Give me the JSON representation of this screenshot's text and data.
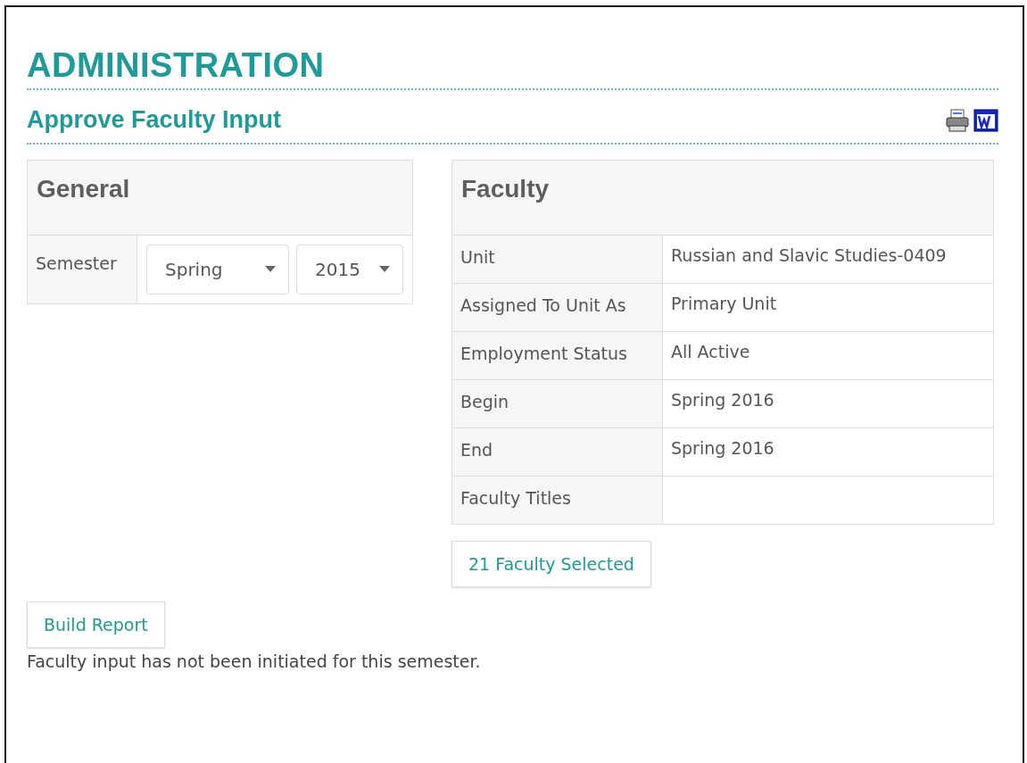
{
  "page_title": "ADMINISTRATION",
  "section_title": "Approve Faculty Input",
  "general": {
    "title": "General",
    "field_label": "Semester",
    "selects": [
      {
        "value": "Spring"
      },
      {
        "value": "2015"
      }
    ]
  },
  "faculty": {
    "title": "Faculty",
    "rows": [
      {
        "label": "Unit",
        "value": "Russian and Slavic Studies-0409"
      },
      {
        "label": "Assigned To Unit As",
        "value": "Primary Unit"
      },
      {
        "label": "Employment Status",
        "value": "All Active"
      },
      {
        "label": "Begin",
        "value": "Spring 2016"
      },
      {
        "label": "End",
        "value": "Spring 2016"
      },
      {
        "label": "Faculty Titles"
      }
    ],
    "selected_button": "21 Faculty Selected"
  },
  "build_button": "Build Report",
  "message": "Faculty input has not been initiated for this semester."
}
